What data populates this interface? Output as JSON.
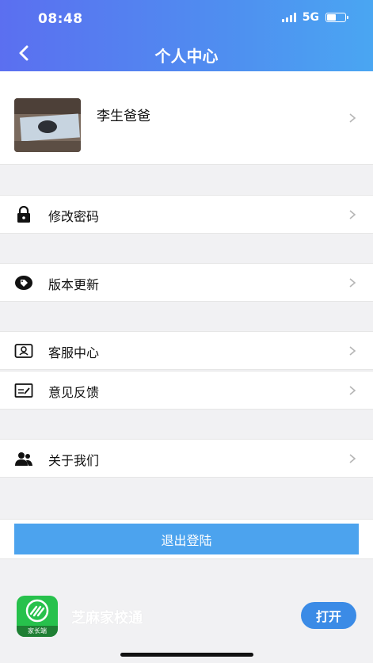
{
  "status_bar": {
    "time": "08:48",
    "network": "5G"
  },
  "header": {
    "title": "个人中心",
    "back_icon": "chevron-left-icon"
  },
  "profile": {
    "name": "李生爸爸"
  },
  "menu": [
    {
      "label": "修改密码",
      "icon": "lock-icon"
    },
    {
      "label": "版本更新",
      "icon": "tag-icon"
    },
    {
      "label": "客服中心",
      "icon": "support-icon"
    },
    {
      "label": "意见反馈",
      "icon": "feedback-icon"
    },
    {
      "label": "关于我们",
      "icon": "users-icon"
    }
  ],
  "logout": {
    "label": "退出登陆"
  },
  "app_banner": {
    "app_name": "芝麻家校通",
    "icon_label": "家长端",
    "open_label": "打开"
  },
  "colors": {
    "header_start": "#5b6ff0",
    "header_end": "#4aa6f2",
    "logout_bg": "#4ca3ee",
    "open_bg": "#3b8be6",
    "app_icon_bg": "#27c14c"
  }
}
